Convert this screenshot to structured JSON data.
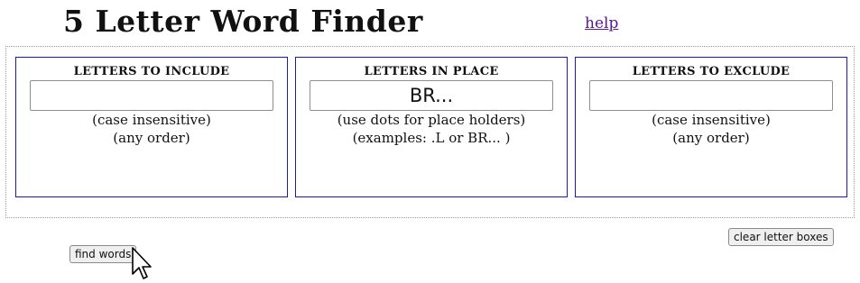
{
  "header": {
    "title": "5 Letter Word Finder",
    "help_link": "help"
  },
  "panels": [
    {
      "heading": "LETTERS TO INCLUDE",
      "value": "",
      "notes": [
        "(case insensitive)",
        "(any order)"
      ]
    },
    {
      "heading": "LETTERS IN PLACE",
      "value": "BR...",
      "notes": [
        "(use dots for place holders)",
        "(examples: .L or BR... )"
      ]
    },
    {
      "heading": "LETTERS TO EXCLUDE",
      "value": "",
      "notes": [
        "(case insensitive)",
        "(any order)"
      ]
    }
  ],
  "buttons": {
    "clear": "clear letter boxes",
    "find": "find words"
  },
  "icons": {
    "cursor": "mouse-pointer-icon"
  }
}
